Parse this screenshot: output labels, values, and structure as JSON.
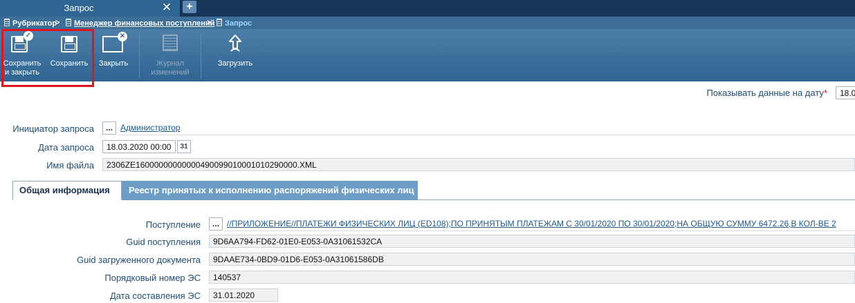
{
  "tab": {
    "title": "Запрос",
    "close": "✕",
    "add": "+"
  },
  "breadcrumb": {
    "item1": "Рубрикатор",
    "sep1": ">",
    "item2": "Менеджер финансовых поступлений",
    "sep2": ">",
    "current": "Запрос"
  },
  "toolbar": {
    "save_close_line1": "Сохранить",
    "save_close_line2": "и закрыть",
    "save": "Сохранить",
    "close": "Закрыть",
    "journal_line1": "Журнал",
    "journal_line2": "изменений",
    "upload": "Загрузить",
    "badge_check": "✓",
    "badge_x": "✕"
  },
  "date_filter": {
    "label": "Показывать данные на дату",
    "required": "*",
    "value": "18.0"
  },
  "form": {
    "initiator_label": "Инициатор запроса",
    "initiator_value": "Администратор",
    "request_date_label": "Дата запроса",
    "request_date_value": "18.03.2020 00:00",
    "calendar_icon_text": "31",
    "file_name_label": "Имя файла",
    "file_name_value": "2306ZE160000000000004900990100010102900​00.XML"
  },
  "tabs": {
    "general": "Общая информация",
    "registry": "Реестр принятых к исполнению распоряжений физических лиц"
  },
  "details": {
    "receipt_label": "Поступление",
    "receipt_value": "//ПРИЛОЖЕНИЕ//ПЛАТЕЖИ ФИЗИЧЕСКИХ ЛИЦ (ED108);ПО ПРИНЯТЫМ ПЛАТЕЖАМ С 30/01/2020 ПО 30/01/2020;НА ОБЩУЮ СУММУ 6472.26,В КОЛ-ВЕ 2",
    "guid_receipt_label": "Guid поступления",
    "guid_receipt_value": "9D6AA794-FD62-01E0-E053-0A31061532CA",
    "guid_doc_label": "Guid загруженного документа",
    "guid_doc_value": "9DAAE734-0BD9-01D6-E053-0A31061586DB",
    "seq_label": "Порядковый номер ЭС",
    "seq_value": "140537",
    "compose_date_label": "Дата составления ЭС",
    "compose_date_value": "31.01.2020"
  },
  "dots": "...",
  "colors": {
    "toolbar": "#3c6f9c",
    "highlight": "#e3141c",
    "link": "#1c5a92",
    "label": "#1f4e7c"
  }
}
